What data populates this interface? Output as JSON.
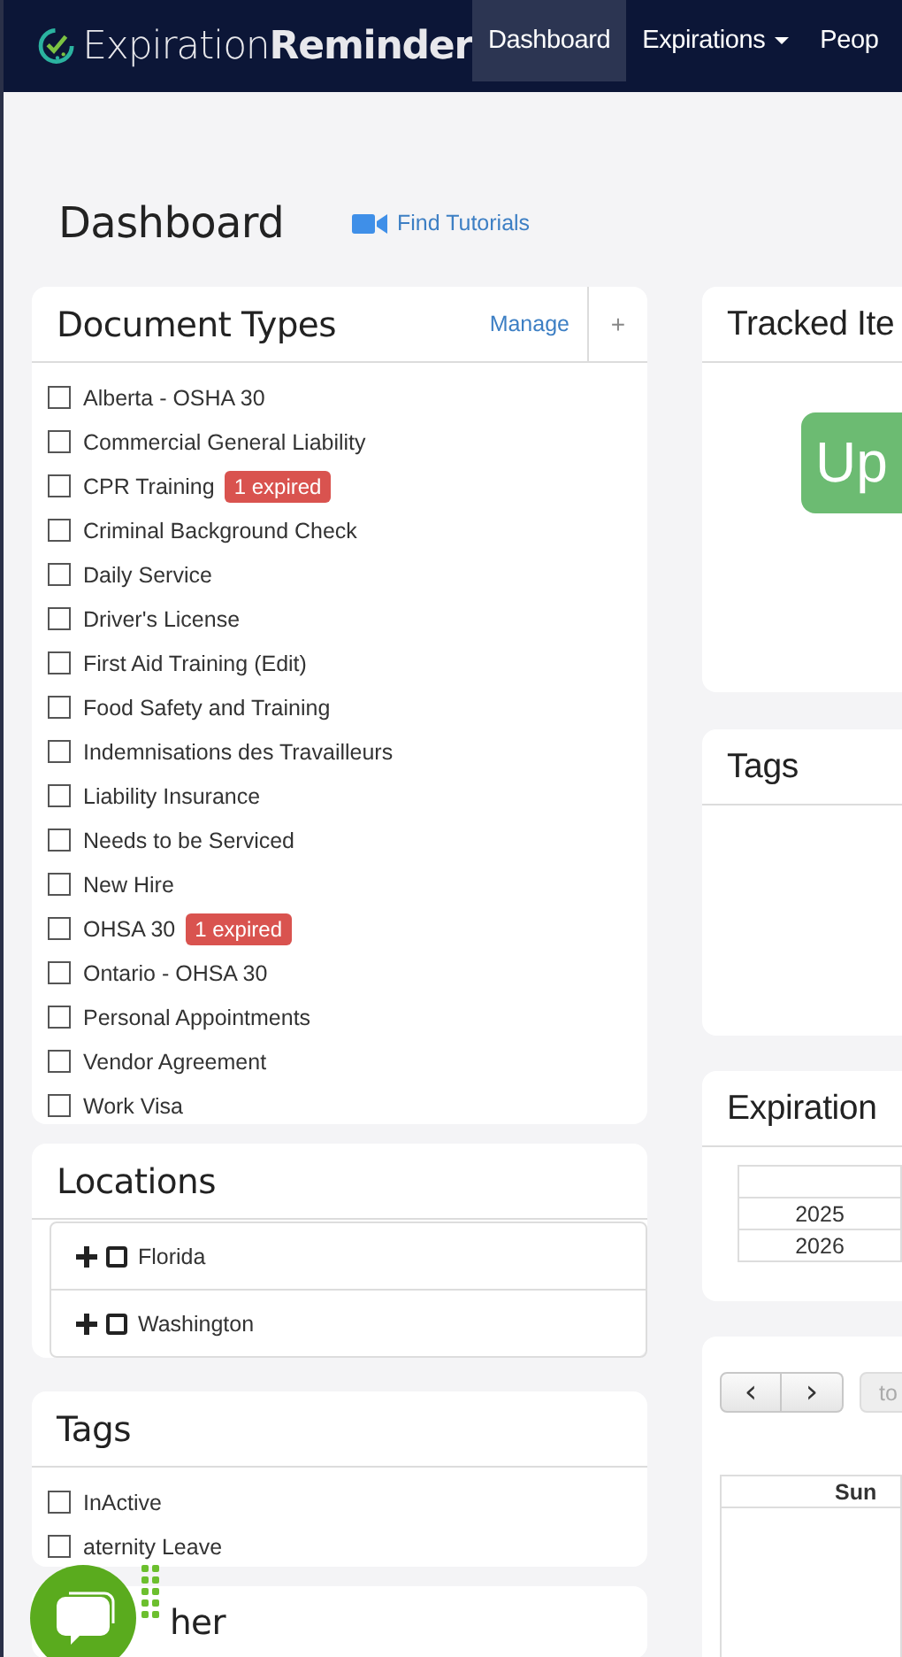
{
  "nav": {
    "logo": {
      "light": "Expiration",
      "bold": "Reminder"
    },
    "items": [
      {
        "label": "Dashboard",
        "selected": true,
        "dropdown": false
      },
      {
        "label": "Expirations",
        "selected": false,
        "dropdown": true
      },
      {
        "label": "Peop",
        "selected": false,
        "dropdown": false
      }
    ]
  },
  "page_title": "Dashboard",
  "tutorials_link": "Find Tutorials",
  "document_types": {
    "title": "Document Types",
    "manage": "Manage",
    "add": "+",
    "items": [
      {
        "label": "Alberta - OSHA 30",
        "checked": false
      },
      {
        "label": "Commercial General Liability",
        "checked": false
      },
      {
        "label": "CPR Training",
        "checked": false,
        "badge": "1 expired"
      },
      {
        "label": "Criminal Background Check",
        "checked": false
      },
      {
        "label": "Daily Service",
        "checked": false
      },
      {
        "label": "Driver's License",
        "checked": false
      },
      {
        "label": "First Aid Training (Edit)",
        "checked": false
      },
      {
        "label": "Food Safety and Training",
        "checked": false
      },
      {
        "label": "Indemnisations des Travailleurs",
        "checked": false
      },
      {
        "label": "Liability Insurance",
        "checked": false
      },
      {
        "label": "Needs to be Serviced",
        "checked": false
      },
      {
        "label": "New Hire",
        "checked": false
      },
      {
        "label": "OHSA 30",
        "checked": false,
        "badge": "1 expired"
      },
      {
        "label": "Ontario - OHSA 30",
        "checked": false
      },
      {
        "label": "Personal Appointments",
        "checked": false
      },
      {
        "label": "Vendor Agreement",
        "checked": false
      },
      {
        "label": "Work Visa",
        "checked": false
      }
    ]
  },
  "locations": {
    "title": "Locations",
    "items": [
      {
        "label": "Florida",
        "expanded": false,
        "checked": false
      },
      {
        "label": "Washington",
        "expanded": false,
        "checked": false
      }
    ]
  },
  "tags": {
    "title": "Tags",
    "items": [
      {
        "label": "InActive",
        "checked": false
      },
      {
        "label": "aternity Leave",
        "checked": false
      }
    ]
  },
  "other": {
    "title": "her"
  },
  "tracked_items": {
    "title": "Tracked Ite",
    "button": "Up"
  },
  "right_tags": {
    "title": "Tags"
  },
  "expiration": {
    "title": "Expiration",
    "rows": [
      "2025",
      "2026"
    ]
  },
  "calendar": {
    "prev": "‹",
    "next": "›",
    "today": "to",
    "columns": [
      "Sun"
    ]
  }
}
